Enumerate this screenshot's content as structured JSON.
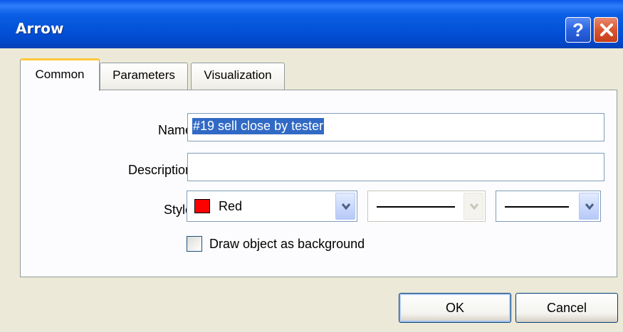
{
  "window": {
    "title": "Arrow",
    "help_label": "?"
  },
  "tabs": [
    {
      "label": "Common",
      "active": true
    },
    {
      "label": "Parameters",
      "active": false
    },
    {
      "label": "Visualization",
      "active": false
    }
  ],
  "form": {
    "name_label": "Name:",
    "name_value": "#19 sell close by tester",
    "description_label": "Description:",
    "description_value": "",
    "style_label": "Style:",
    "color_value": "Red",
    "color_swatch": "#ff0000",
    "checkbox_label": "Draw object as background",
    "checkbox_checked": false
  },
  "buttons": {
    "ok_label": "OK",
    "cancel_label": "Cancel"
  },
  "icons": {
    "help": "question-mark-icon",
    "close": "close-x-icon",
    "dropdown": "chevron-down-icon"
  }
}
